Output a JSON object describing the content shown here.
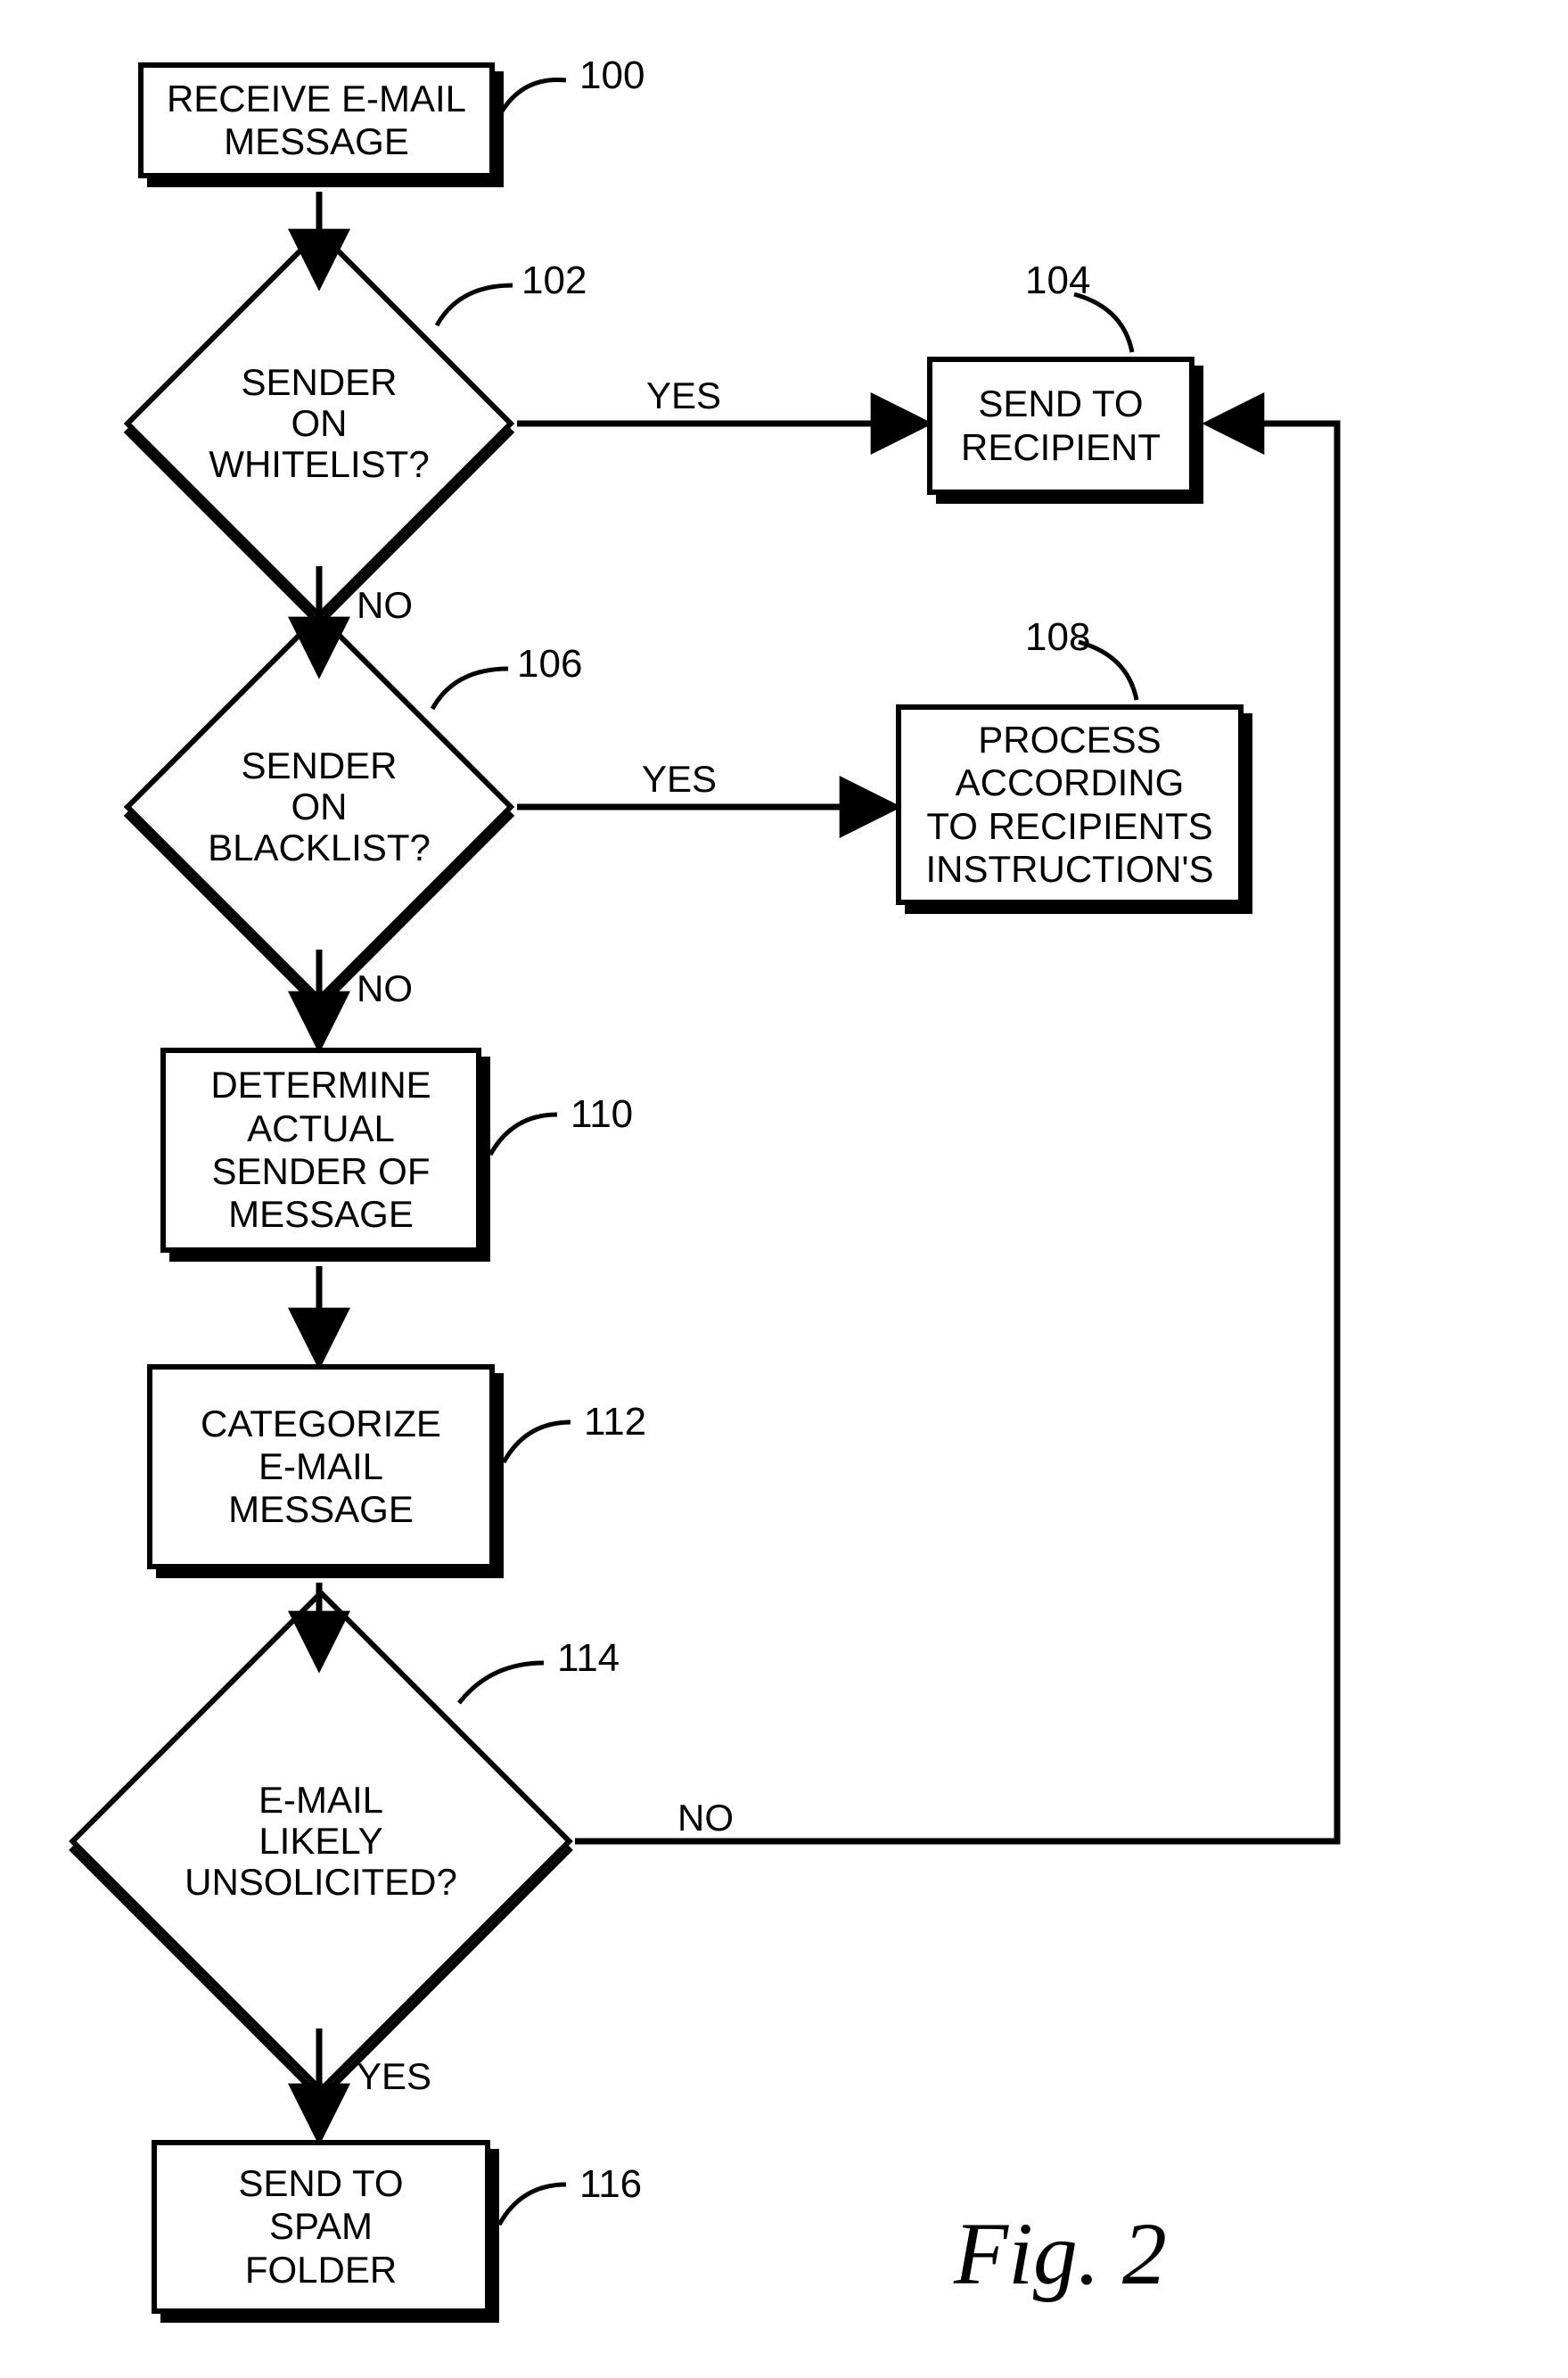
{
  "nodes": {
    "n100": {
      "text": "RECEIVE E-MAIL\nMESSAGE",
      "ref": "100"
    },
    "n102": {
      "text": "SENDER\nON WHITELIST?",
      "ref": "102"
    },
    "n104": {
      "text": "SEND TO\nRECIPIENT",
      "ref": "104"
    },
    "n106": {
      "text": "SENDER\nON BLACKLIST?",
      "ref": "106"
    },
    "n108": {
      "text": "PROCESS\nACCORDING\nTO RECIPIENTS\nINSTRUCTION'S",
      "ref": "108"
    },
    "n110": {
      "text": "DETERMINE\nACTUAL\nSENDER OF\nMESSAGE",
      "ref": "110"
    },
    "n112": {
      "text": "CATEGORIZE\nE-MAIL\nMESSAGE",
      "ref": "112"
    },
    "n114": {
      "text": "E-MAIL\nLIKELY\nUNSOLICITED?",
      "ref": "114"
    },
    "n116": {
      "text": "SEND TO\nSPAM\nFOLDER",
      "ref": "116"
    }
  },
  "edge_labels": {
    "yes102": "YES",
    "no102": "NO",
    "yes106": "YES",
    "no106": "NO",
    "no114": "NO",
    "yes114": "YES"
  },
  "figure": "Fig. 2",
  "chart_data": {
    "type": "flowchart",
    "title": "Fig. 2",
    "nodes": [
      {
        "id": "100",
        "shape": "process",
        "text": "RECEIVE E-MAIL MESSAGE"
      },
      {
        "id": "102",
        "shape": "decision",
        "text": "SENDER ON WHITELIST?"
      },
      {
        "id": "104",
        "shape": "process",
        "text": "SEND TO RECIPIENT"
      },
      {
        "id": "106",
        "shape": "decision",
        "text": "SENDER ON BLACKLIST?"
      },
      {
        "id": "108",
        "shape": "process",
        "text": "PROCESS ACCORDING TO RECIPIENTS INSTRUCTION'S"
      },
      {
        "id": "110",
        "shape": "process",
        "text": "DETERMINE ACTUAL SENDER OF MESSAGE"
      },
      {
        "id": "112",
        "shape": "process",
        "text": "CATEGORIZE E-MAIL MESSAGE"
      },
      {
        "id": "114",
        "shape": "decision",
        "text": "E-MAIL LIKELY UNSOLICITED?"
      },
      {
        "id": "116",
        "shape": "process",
        "text": "SEND TO SPAM FOLDER"
      }
    ],
    "edges": [
      {
        "from": "100",
        "to": "102",
        "label": ""
      },
      {
        "from": "102",
        "to": "104",
        "label": "YES"
      },
      {
        "from": "102",
        "to": "106",
        "label": "NO"
      },
      {
        "from": "106",
        "to": "108",
        "label": "YES"
      },
      {
        "from": "106",
        "to": "110",
        "label": "NO"
      },
      {
        "from": "110",
        "to": "112",
        "label": ""
      },
      {
        "from": "112",
        "to": "114",
        "label": ""
      },
      {
        "from": "114",
        "to": "104",
        "label": "NO"
      },
      {
        "from": "114",
        "to": "116",
        "label": "YES"
      }
    ]
  }
}
